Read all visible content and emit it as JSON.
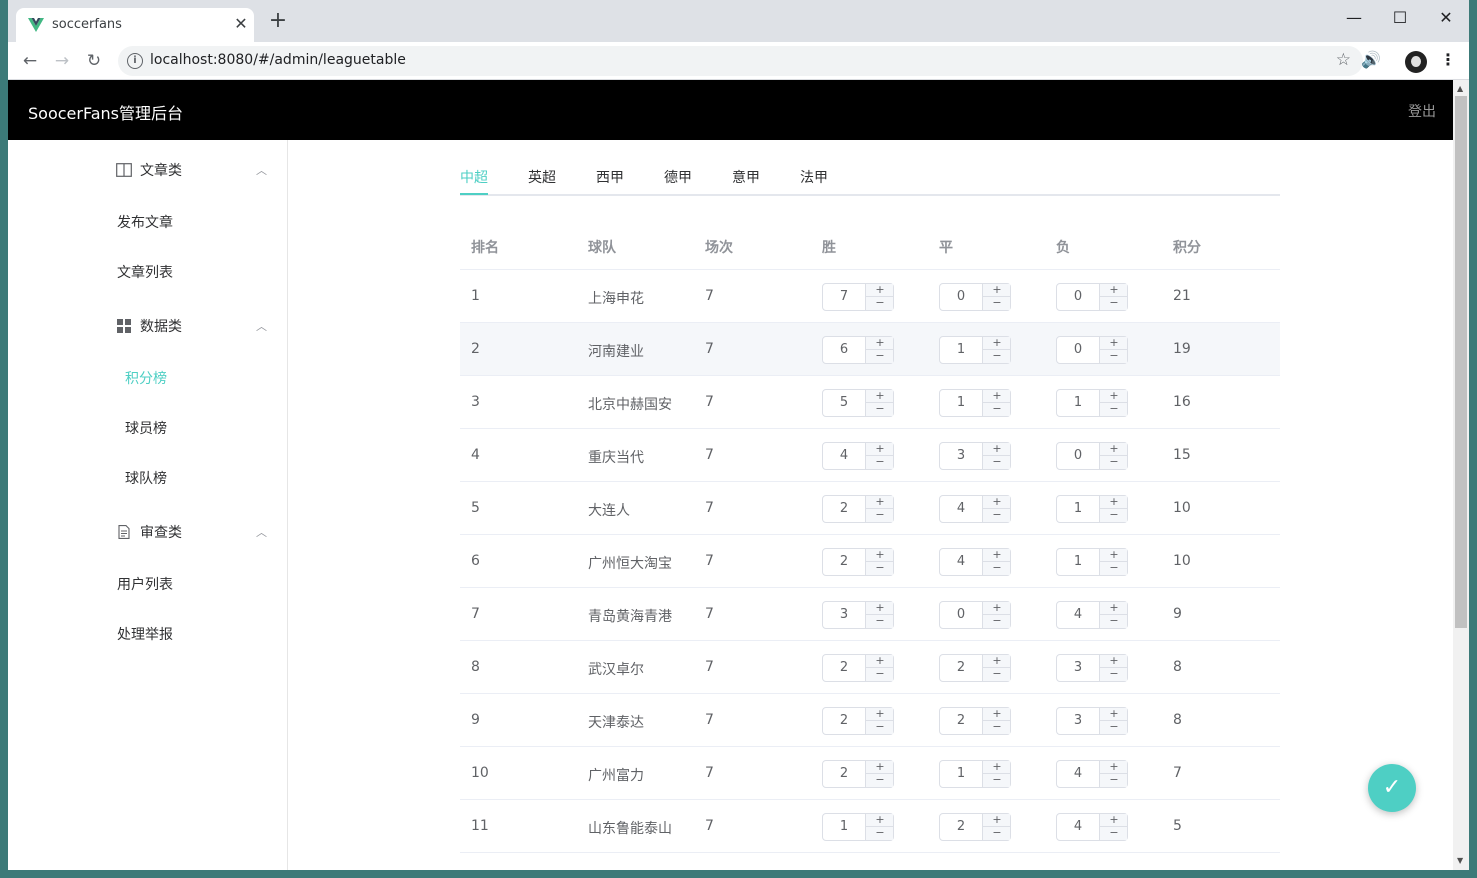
{
  "browser": {
    "tab_title": "soccerfans",
    "url": "localhost:8080/#/admin/leaguetable"
  },
  "app": {
    "title": "SoocerFans管理后台",
    "logout": "登出"
  },
  "sidebar": {
    "groups": [
      {
        "label": "文章类",
        "icon": "book-icon",
        "items": [
          "发布文章",
          "文章列表"
        ]
      },
      {
        "label": "数据类",
        "icon": "grid-icon",
        "items": [
          "积分榜",
          "球员榜",
          "球队榜"
        ]
      },
      {
        "label": "审查类",
        "icon": "document-icon",
        "items": [
          "用户列表",
          "处理举报"
        ]
      }
    ],
    "active_item": "积分榜"
  },
  "league_tabs": [
    "中超",
    "英超",
    "西甲",
    "德甲",
    "意甲",
    "法甲"
  ],
  "active_tab": "中超",
  "table": {
    "headers": [
      "排名",
      "球队",
      "场次",
      "胜",
      "平",
      "负",
      "积分"
    ],
    "rows": [
      {
        "rank": "1",
        "team": "上海申花",
        "played": "7",
        "win": "7",
        "draw": "0",
        "loss": "0",
        "points": "21"
      },
      {
        "rank": "2",
        "team": "河南建业",
        "played": "7",
        "win": "6",
        "draw": "1",
        "loss": "0",
        "points": "19"
      },
      {
        "rank": "3",
        "team": "北京中赫国安",
        "played": "7",
        "win": "5",
        "draw": "1",
        "loss": "1",
        "points": "16"
      },
      {
        "rank": "4",
        "team": "重庆当代",
        "played": "7",
        "win": "4",
        "draw": "3",
        "loss": "0",
        "points": "15"
      },
      {
        "rank": "5",
        "team": "大连人",
        "played": "7",
        "win": "2",
        "draw": "4",
        "loss": "1",
        "points": "10"
      },
      {
        "rank": "6",
        "team": "广州恒大淘宝",
        "played": "7",
        "win": "2",
        "draw": "4",
        "loss": "1",
        "points": "10"
      },
      {
        "rank": "7",
        "team": "青岛黄海青港",
        "played": "7",
        "win": "3",
        "draw": "0",
        "loss": "4",
        "points": "9"
      },
      {
        "rank": "8",
        "team": "武汉卓尔",
        "played": "7",
        "win": "2",
        "draw": "2",
        "loss": "3",
        "points": "8"
      },
      {
        "rank": "9",
        "team": "天津泰达",
        "played": "7",
        "win": "2",
        "draw": "2",
        "loss": "3",
        "points": "8"
      },
      {
        "rank": "10",
        "team": "广州富力",
        "played": "7",
        "win": "2",
        "draw": "1",
        "loss": "4",
        "points": "7"
      },
      {
        "rank": "11",
        "team": "山东鲁能泰山",
        "played": "7",
        "win": "1",
        "draw": "2",
        "loss": "4",
        "points": "5"
      }
    ]
  },
  "stepper": {
    "plus": "+",
    "minus": "−"
  },
  "colors": {
    "accent": "#4ecfc4",
    "header_bg": "#000000"
  }
}
